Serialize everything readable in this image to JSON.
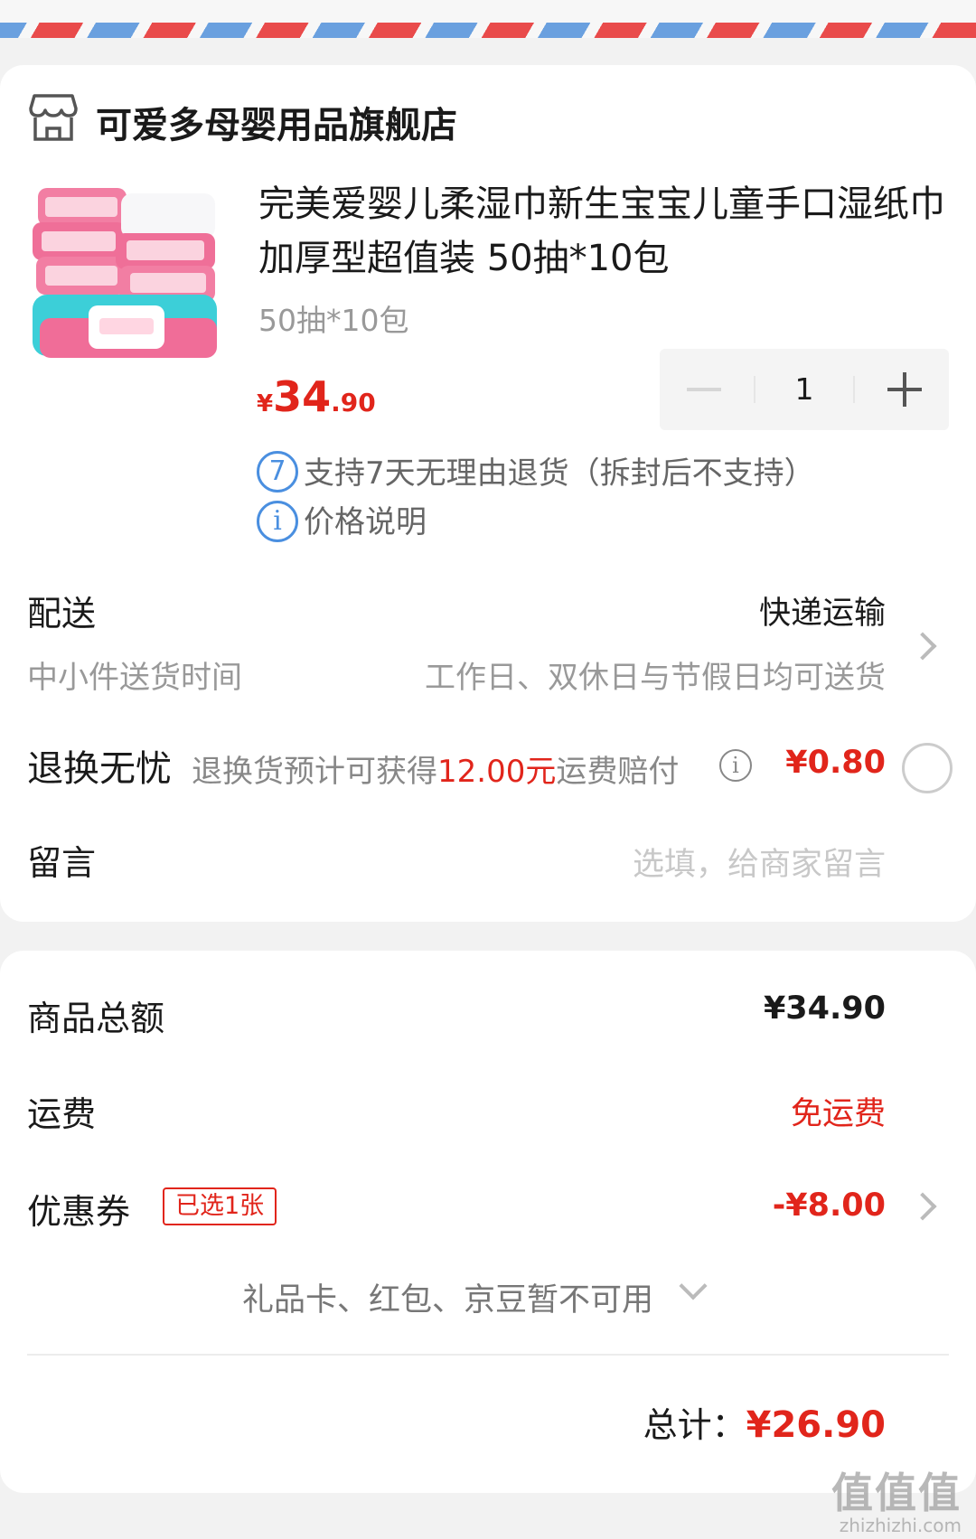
{
  "colors": {
    "accent": "#e1251b",
    "info_blue": "#4a8fe0"
  },
  "store": {
    "name": "可爱多母婴用品旗舰店",
    "icon": "store-icon"
  },
  "product": {
    "title": "完美爱婴儿柔湿巾新生宝宝儿童手口湿纸巾加厚型超值装 50抽*10包",
    "spec": "50抽*10包",
    "price_currency": "¥",
    "price_int": "34",
    "price_dec": ".90",
    "quantity": "1"
  },
  "services": [
    {
      "icon_text": "7",
      "text": "支持7天无理由退货（拆封后不支持）"
    },
    {
      "icon_text": "i",
      "text": "价格说明"
    }
  ],
  "delivery": {
    "label": "配送",
    "method": "快递运输",
    "time_label": "中小件送货时间",
    "time_value": "工作日、双休日与节假日均可送货"
  },
  "return_insurance": {
    "label": "退换无忧",
    "text_before": "退换货预计可获得",
    "highlight": "12.00元",
    "text_after": "运费赔付",
    "info_icon": "i",
    "price": "¥0.80"
  },
  "message": {
    "label": "留言",
    "placeholder": "选填，给商家留言"
  },
  "summary": {
    "goods_label": "商品总额",
    "goods_value": "¥34.90",
    "shipping_label": "运费",
    "shipping_value": "免运费",
    "coupon_label": "优惠券",
    "coupon_badge": "已选1张",
    "coupon_value": "-¥8.00",
    "gift_text": "礼品卡、红包、京豆暂不可用",
    "total_label": "总计：",
    "total_value": "¥26.90"
  },
  "watermark": {
    "main": "值值值",
    "sub": "zhizhizhi.com"
  }
}
